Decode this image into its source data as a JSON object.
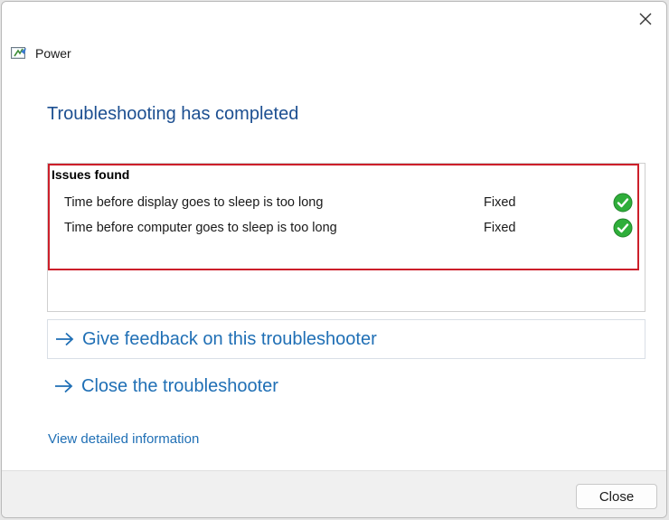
{
  "window": {
    "title": "Power",
    "app_icon": "power-troubleshooter-icon",
    "close_icon": "close-icon"
  },
  "heading": "Troubleshooting has completed",
  "issues": {
    "label": "Issues found",
    "items": [
      {
        "text": "Time before display goes to sleep is too long",
        "status": "Fixed",
        "icon": "green-checkmark-icon"
      },
      {
        "text": "Time before computer goes to sleep is too long",
        "status": "Fixed",
        "icon": "green-checkmark-icon"
      }
    ]
  },
  "links": {
    "feedback": "Give feedback on this troubleshooter",
    "close_troubleshooter": "Close the troubleshooter",
    "detailed_info": "View detailed information"
  },
  "footer": {
    "close_button": "Close"
  },
  "colors": {
    "heading": "#1c4f91",
    "link": "#1f6fb5",
    "highlight_border": "#cc1f2a",
    "check_green": "#2fae3a"
  }
}
